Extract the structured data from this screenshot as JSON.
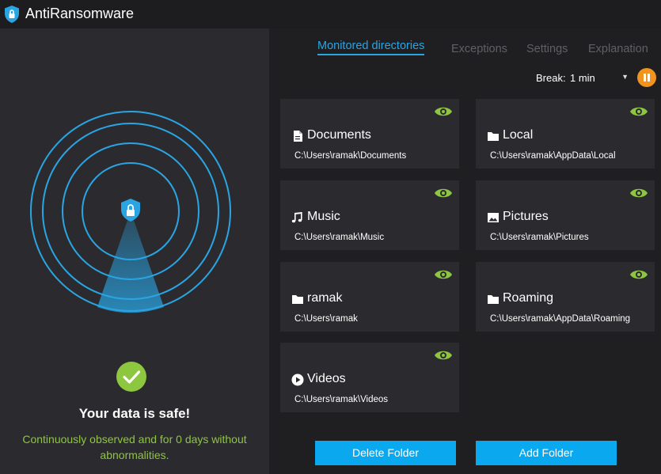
{
  "app": {
    "title": "AntiRansomware"
  },
  "status": {
    "title": "Your data is safe!",
    "subtitle_line1": "Continuously observed and for 0 days without",
    "subtitle_line2": "abnormalities."
  },
  "tabs": [
    {
      "label": "Monitored directories",
      "active": true
    },
    {
      "label": "Exceptions",
      "active": false
    },
    {
      "label": "Settings",
      "active": false
    },
    {
      "label": "Explanation",
      "active": false
    }
  ],
  "break": {
    "label": "Break:",
    "value": "1 min"
  },
  "folders": [
    {
      "name": "Documents",
      "path": "C:\\Users\\ramak\\Documents",
      "icon": "document-icon"
    },
    {
      "name": "Local",
      "path": "C:\\Users\\ramak\\AppData\\Local",
      "icon": "folder-icon"
    },
    {
      "name": "Music",
      "path": "C:\\Users\\ramak\\Music",
      "icon": "music-icon"
    },
    {
      "name": "Pictures",
      "path": "C:\\Users\\ramak\\Pictures",
      "icon": "picture-icon"
    },
    {
      "name": "ramak",
      "path": "C:\\Users\\ramak",
      "icon": "folder-icon"
    },
    {
      "name": "Roaming",
      "path": "C:\\Users\\ramak\\AppData\\Roaming",
      "icon": "folder-icon"
    },
    {
      "name": "Videos",
      "path": "C:\\Users\\ramak\\Videos",
      "icon": "play-icon"
    }
  ],
  "buttons": {
    "delete": "Delete Folder",
    "add": "Add Folder"
  },
  "colors": {
    "accent": "#2aa5e4",
    "button": "#0aa8ef",
    "safe_green": "#8dc63f",
    "eye_green": "#8dc63f",
    "pause_orange": "#f0941e"
  }
}
